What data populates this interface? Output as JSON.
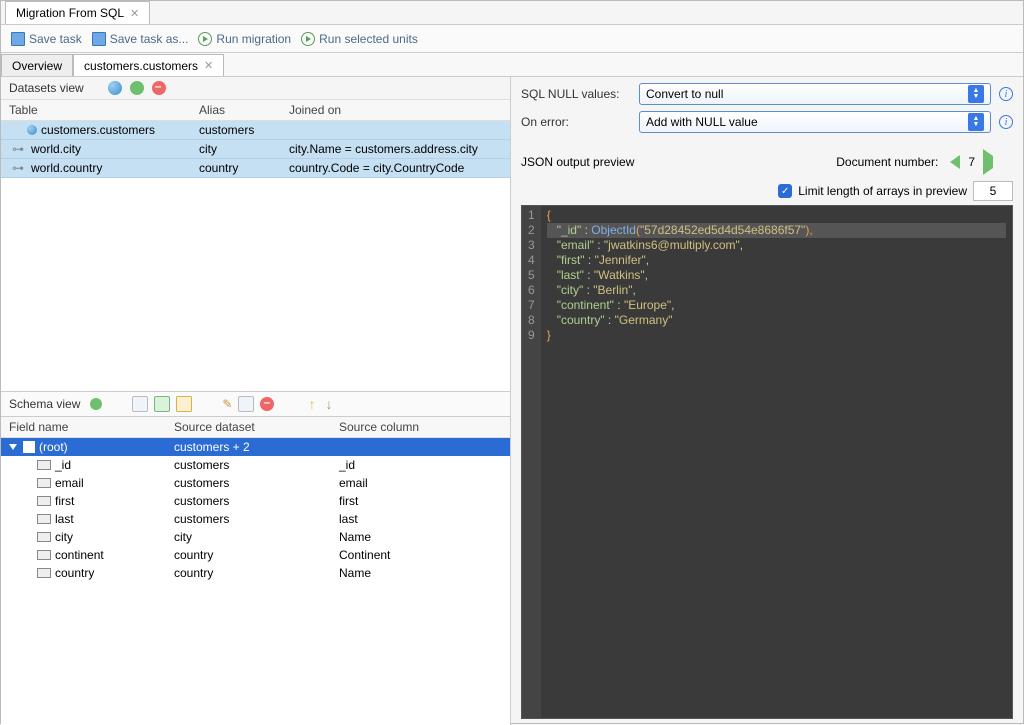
{
  "window": {
    "tab_title": "Migration From SQL"
  },
  "toolbar": {
    "save_task": "Save task",
    "save_task_as": "Save task as...",
    "run_migration": "Run migration",
    "run_selected": "Run selected units"
  },
  "sub_tabs": {
    "overview": "Overview",
    "current": "customers.customers"
  },
  "datasets_view": {
    "title": "Datasets view",
    "headers": {
      "table": "Table",
      "alias": "Alias",
      "joined": "Joined on"
    },
    "rows": [
      {
        "table": "customers.customers",
        "alias": "customers",
        "joined": ""
      },
      {
        "table": "world.city",
        "alias": "city",
        "joined": "city.Name = customers.address.city"
      },
      {
        "table": "world.country",
        "alias": "country",
        "joined": "country.Code = city.CountryCode"
      }
    ]
  },
  "schema_view": {
    "title": "Schema view",
    "headers": {
      "field": "Field name",
      "source_dataset": "Source dataset",
      "source_column": "Source column"
    },
    "root": {
      "label": "(root)",
      "dataset": "customers + 2"
    },
    "rows": [
      {
        "field": "_id",
        "dataset": "customers",
        "column": "_id"
      },
      {
        "field": "email",
        "dataset": "customers",
        "column": "email"
      },
      {
        "field": "first",
        "dataset": "customers",
        "column": "first"
      },
      {
        "field": "last",
        "dataset": "customers",
        "column": "last"
      },
      {
        "field": "city",
        "dataset": "city",
        "column": "Name"
      },
      {
        "field": "continent",
        "dataset": "country",
        "column": "Continent"
      },
      {
        "field": "country",
        "dataset": "country",
        "column": "Name"
      }
    ]
  },
  "right_form": {
    "sql_null_label": "SQL NULL values:",
    "sql_null_value": "Convert to null",
    "on_error_label": "On error:",
    "on_error_value": "Add with NULL value"
  },
  "preview": {
    "title": "JSON output preview",
    "doc_label": "Document number:",
    "doc_number": "7",
    "limit_label": "Limit length of arrays in preview",
    "limit_value": "5"
  },
  "json_preview": {
    "line1": "{",
    "line2_key": "\"_id\"",
    "line2_fn": "ObjectId",
    "line2_arg": "\"57d28452ed5d4d54e8686f57\"",
    "line3_key": "\"email\"",
    "line3_val": "\"jwatkins6@multiply.com\"",
    "line4_key": "\"first\"",
    "line4_val": "\"Jennifer\"",
    "line5_key": "\"last\"",
    "line5_val": "\"Watkins\"",
    "line6_key": "\"city\"",
    "line6_val": "\"Berlin\"",
    "line7_key": "\"continent\"",
    "line7_val": "\"Europe\"",
    "line8_key": "\"country\"",
    "line8_val": "\"Germany\"",
    "line9": "}"
  }
}
